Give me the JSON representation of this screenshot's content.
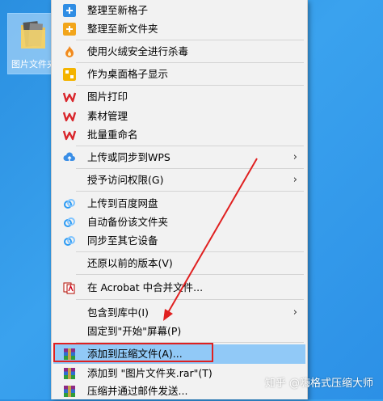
{
  "desktop": {
    "icon_label": "图片文件夹"
  },
  "menu": {
    "items": [
      {
        "label": "整理至新格子",
        "icon": "plus-square-icon-blue"
      },
      {
        "label": "整理至新文件夹",
        "icon": "plus-square-icon-orange"
      },
      {
        "label": "使用火绒安全进行杀毒",
        "icon": "huorong-flame-icon"
      },
      {
        "label": "作为桌面格子显示",
        "icon": "desktop-grid-icon"
      },
      {
        "label": "图片打印",
        "icon": "wps-icon"
      },
      {
        "label": "素材管理",
        "icon": "wps-icon"
      },
      {
        "label": "批量重命名",
        "icon": "wps-icon"
      },
      {
        "label": "上传或同步到WPS",
        "icon": "cloud-upload-icon"
      },
      {
        "label": "授予访问权限(G)",
        "icon": ""
      },
      {
        "label": "上传到百度网盘",
        "icon": "baidu-netdisk-icon"
      },
      {
        "label": "自动备份该文件夹",
        "icon": "baidu-netdisk-icon"
      },
      {
        "label": "同步至其它设备",
        "icon": "baidu-netdisk-icon"
      },
      {
        "label": "还原以前的版本(V)",
        "icon": ""
      },
      {
        "label": "在 Acrobat 中合并文件...",
        "icon": "acrobat-icon"
      },
      {
        "label": "包含到库中(I)",
        "icon": ""
      },
      {
        "label": "固定到\"开始\"屏幕(P)",
        "icon": ""
      },
      {
        "label": "添加到压缩文件(A)...",
        "icon": "winrar-icon"
      },
      {
        "label": "添加到 \"图片文件夹.rar\"(T)",
        "icon": "winrar-icon"
      },
      {
        "label": "压缩并通过邮件发送...",
        "icon": "winrar-icon"
      }
    ],
    "submenu_arrow": "›"
  },
  "watermark": "知乎 @嗨格式压缩大师",
  "colors": {
    "highlight": "#91c9f7",
    "annotation_red": "#e02020",
    "wps_red": "#d9262c"
  }
}
